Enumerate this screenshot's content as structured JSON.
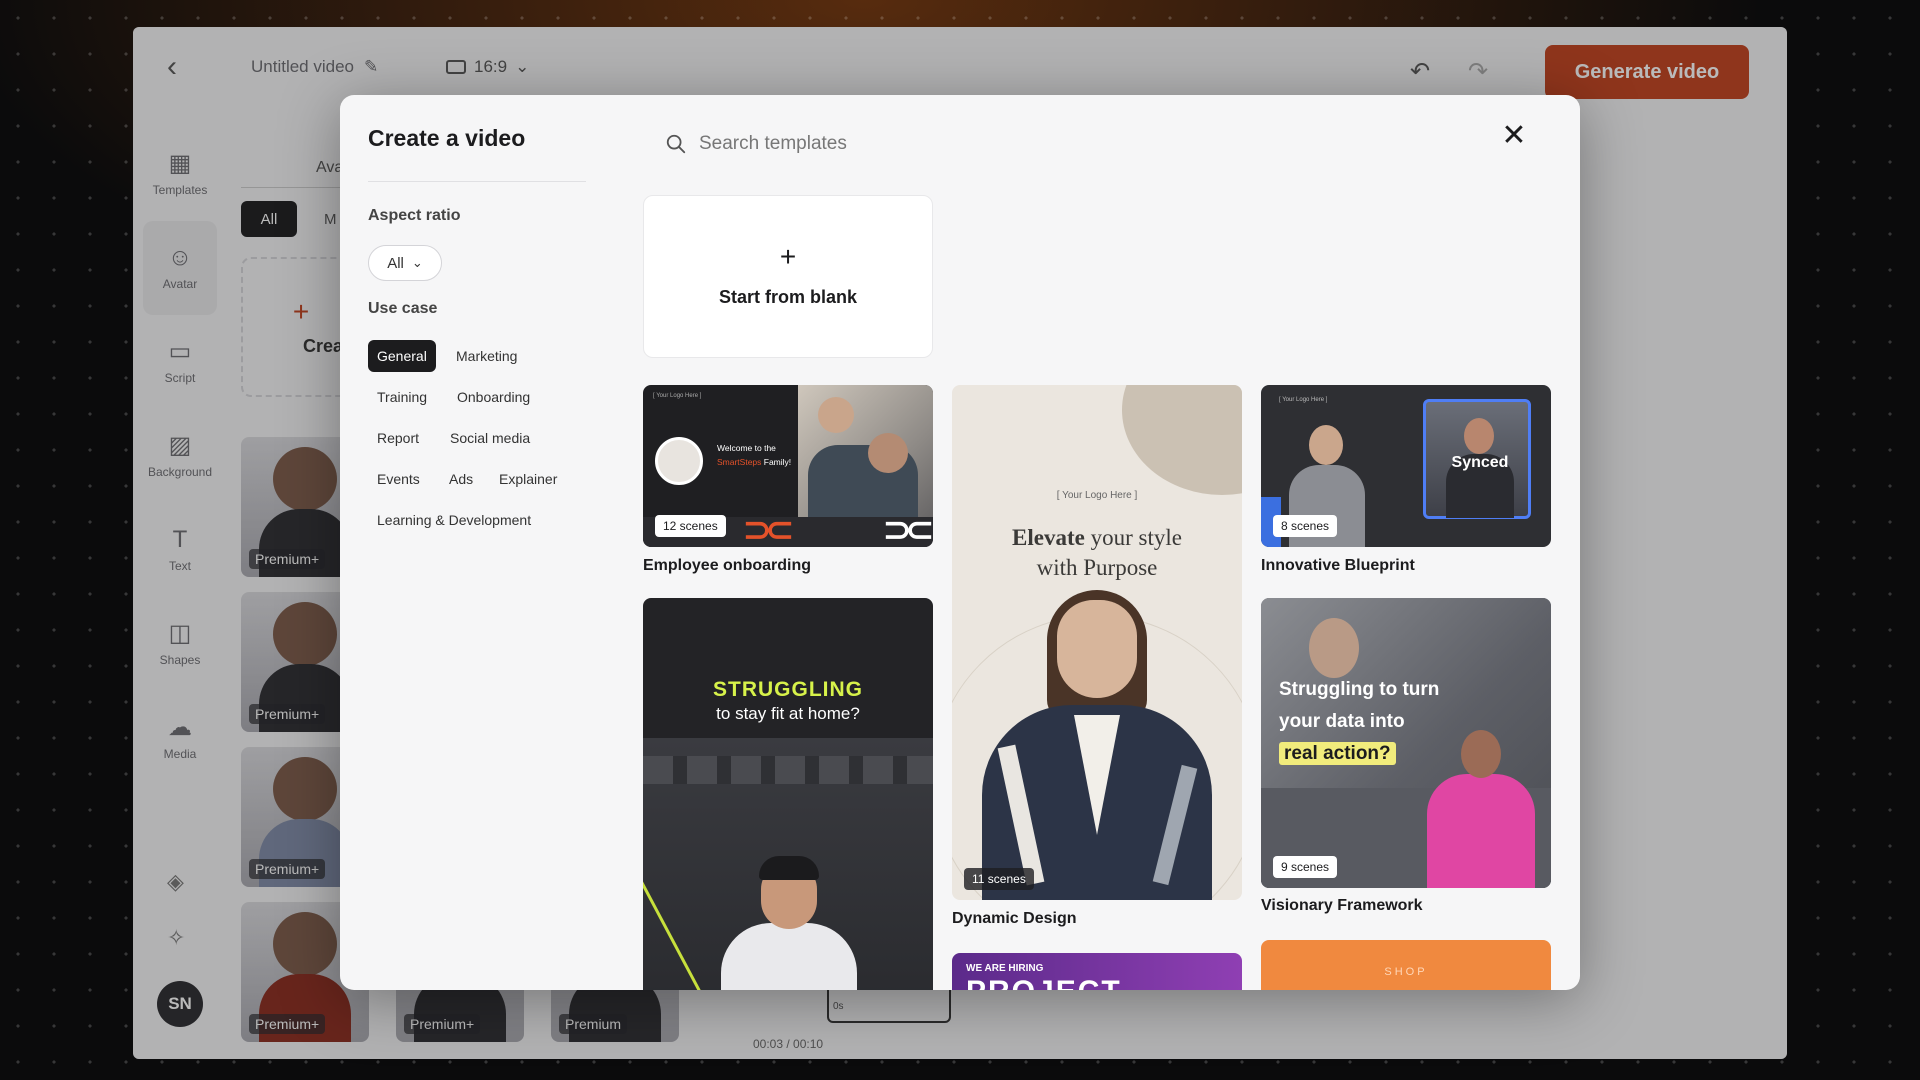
{
  "app": {
    "video_title": "Untitled video",
    "aspect_ratio": "16:9",
    "generate_label": "Generate video",
    "user_initials": "SN",
    "accent_color": "#c2411d",
    "rail": [
      {
        "label": "Templates",
        "icon": "templates-icon"
      },
      {
        "label": "Avatar",
        "icon": "avatar-icon"
      },
      {
        "label": "Script",
        "icon": "script-icon"
      },
      {
        "label": "Background",
        "icon": "background-icon"
      },
      {
        "label": "Text",
        "icon": "text-icon"
      },
      {
        "label": "Shapes",
        "icon": "shapes-icon"
      },
      {
        "label": "Media",
        "icon": "media-icon"
      }
    ],
    "panel": {
      "tab": "Ava",
      "filter_all": "All",
      "filter_my": "M",
      "create_label": "Create",
      "premium_label": "Premium+",
      "premium_plain": "Premium"
    },
    "timeline": {
      "time": "00:03 / 00:10",
      "clip_label": "0s"
    }
  },
  "modal": {
    "title": "Create a video",
    "search_placeholder": "Search templates",
    "aspect_ratio_label": "Aspect ratio",
    "aspect_ratio_value": "All",
    "use_case_label": "Use case",
    "use_cases": [
      "General",
      "Marketing",
      "Training",
      "Onboarding",
      "Report",
      "Social media",
      "Events",
      "Ads",
      "Explainer",
      "Learning & Development"
    ],
    "selected_use_case": "General",
    "start_blank": "Start from blank",
    "templates": {
      "t1": {
        "name": "Employee onboarding",
        "scenes": "12 scenes",
        "logo_text": "[ Your Logo Here ]",
        "msg_a": "Welcome to the ",
        "msg_brand": "SmartSteps",
        "msg_b": " Family!"
      },
      "t2": {
        "name": "Dynamic Design",
        "scenes": "11 scenes",
        "logo_text": "[ Your Logo Here ]",
        "headline_bold": "Elevate",
        "headline_rest": " your style",
        "headline_line2": "with Purpose"
      },
      "t3": {
        "name": "Innovative Blueprint",
        "scenes": "8 scenes",
        "logo_text": "[ Your Logo Here ]",
        "overlay": "Synced"
      },
      "t4": {
        "headline1": "STRUGGLING",
        "headline2": "to stay fit at home?"
      },
      "t5": {
        "name": "Visionary Framework",
        "scenes": "9 scenes",
        "line1": "Struggling to turn",
        "line2": "your data into",
        "line3": "real action?"
      },
      "t6": {
        "kicker": "WE ARE HIRING",
        "title": "PROJECT"
      },
      "t7": {
        "text": "SHOP"
      }
    }
  }
}
